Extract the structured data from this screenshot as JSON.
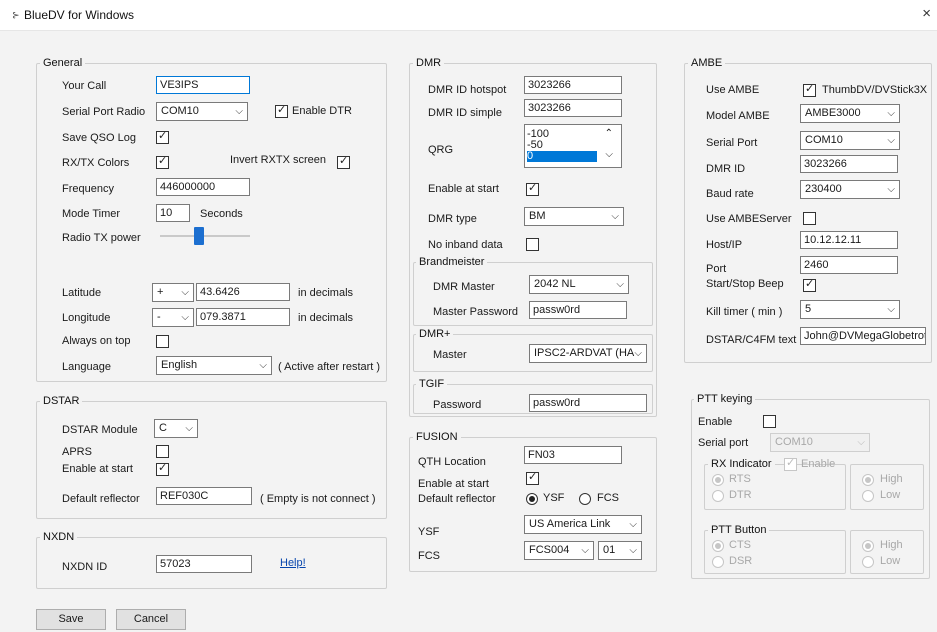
{
  "window": {
    "title": "BlueDV for Windows",
    "close_glyph": "×"
  },
  "general": {
    "title": "General",
    "your_call_label": "Your Call",
    "your_call_value": "VE3IPS",
    "serial_port_label": "Serial Port Radio",
    "serial_port_value": "COM10",
    "enable_dtr_label": "Enable DTR",
    "enable_dtr_checked": true,
    "save_qso_label": "Save QSO Log",
    "rxtx_colors_label": "RX/TX Colors",
    "invert_label": "Invert RXTX screen",
    "frequency_label": "Frequency",
    "frequency_value": "446000000",
    "mode_timer_label": "Mode Timer",
    "mode_timer_value": "10",
    "seconds_label": "Seconds",
    "radio_tx_power_label": "Radio TX power",
    "latitude_label": "Latitude",
    "latitude_sign": "+",
    "latitude_value": "43.6426",
    "lat_units": "in decimals",
    "longitude_label": "Longitude",
    "longitude_sign": "-",
    "longitude_value": "079.3871",
    "lon_units": "in decimals",
    "always_on_top_label": "Always on top",
    "language_label": "Language",
    "language_value": "English",
    "language_note": "( Active after restart )"
  },
  "dstar": {
    "title": "DSTAR",
    "module_label": "DSTAR Module",
    "module_value": "C",
    "aprs_label": "APRS",
    "enable_label": "Enable at start",
    "reflector_label": "Default reflector",
    "reflector_value": "REF030C",
    "reflector_note": "( Empty is not connect )"
  },
  "nxdn": {
    "title": "NXDN",
    "id_label": "NXDN ID",
    "id_value": "57023",
    "help_link": "Help!"
  },
  "dmr": {
    "title": "DMR",
    "hotspot_label": "DMR ID hotspot",
    "hotspot_value": "3023266",
    "simple_label": "DMR ID simple",
    "simple_value": "3023266",
    "qrg_label": "QRG",
    "qrg_items": [
      "-100",
      "-50",
      "0"
    ],
    "enable_label": "Enable at start",
    "type_label": "DMR type",
    "type_value": "BM",
    "no_inband_label": "No inband data",
    "brandmeister_title": "Brandmeister",
    "master_label": "DMR Master",
    "master_value": "2042 NL",
    "master_pw_label": "Master Password",
    "master_pw_value": "passw0rd",
    "dmrplus_title": "DMR+",
    "dmrplus_master_label": "Master",
    "dmrplus_master_value": "IPSC2-ARDVAT (HA",
    "tgif_title": "TGIF",
    "tgif_pw_label": "Password",
    "tgif_pw_value": "passw0rd"
  },
  "fusion": {
    "title": "FUSION",
    "qth_label": "QTH Location",
    "qth_value": "FN03",
    "enable_label": "Enable at start",
    "reflector_label": "Default reflector",
    "ysf_radio_label": "YSF",
    "fcs_radio_label": "FCS",
    "ysf_label": "YSF",
    "ysf_value": "US America Link",
    "fcs_label": "FCS",
    "fcs_value": "FCS004",
    "fcs_room_value": "01"
  },
  "ambe": {
    "title": "AMBE",
    "use_ambe_label": "Use AMBE",
    "device_label": "ThumbDV/DVStick3X",
    "model_label": "Model AMBE",
    "model_value": "AMBE3000",
    "serial_label": "Serial Port",
    "serial_value": "COM10",
    "dmrid_label": "DMR ID",
    "dmrid_value": "3023266",
    "baud_label": "Baud rate",
    "baud_value": "230400",
    "server_label": "Use AMBEServer",
    "host_label": "Host/IP",
    "host_value": "10.12.12.11",
    "port_label": "Port",
    "port_value": "2460",
    "beep_label": "Start/Stop Beep",
    "kill_label": "Kill timer ( min )",
    "kill_value": "5",
    "text_label": "DSTAR/C4FM text",
    "text_value": "John@DVMegaGlobetrot"
  },
  "ptt": {
    "title": "PTT keying",
    "enable_label": "Enable",
    "serial_label": "Serial port",
    "serial_value": "COM10",
    "rx_title": "RX Indicator",
    "rx_enable_label": "Enable",
    "rts_label": "RTS",
    "dtr_label": "DTR",
    "high_label": "High",
    "low_label": "Low",
    "ptt_btn_title": "PTT Button",
    "cts_label": "CTS",
    "dsr_label": "DSR",
    "high2_label": "High",
    "low2_label": "Low"
  },
  "buttons": {
    "save": "Save",
    "cancel": "Cancel"
  },
  "controls": {
    "radio_tx_power_level": 0.42
  },
  "colors": {
    "accent": "#0078d7",
    "slider": "#1c6fd0",
    "link": "#0645ad"
  },
  "icons": {
    "check": "check-icon",
    "dropdown": "chevron-down-icon",
    "scroll_up": "chevron-up-icon",
    "close": "close-icon"
  }
}
